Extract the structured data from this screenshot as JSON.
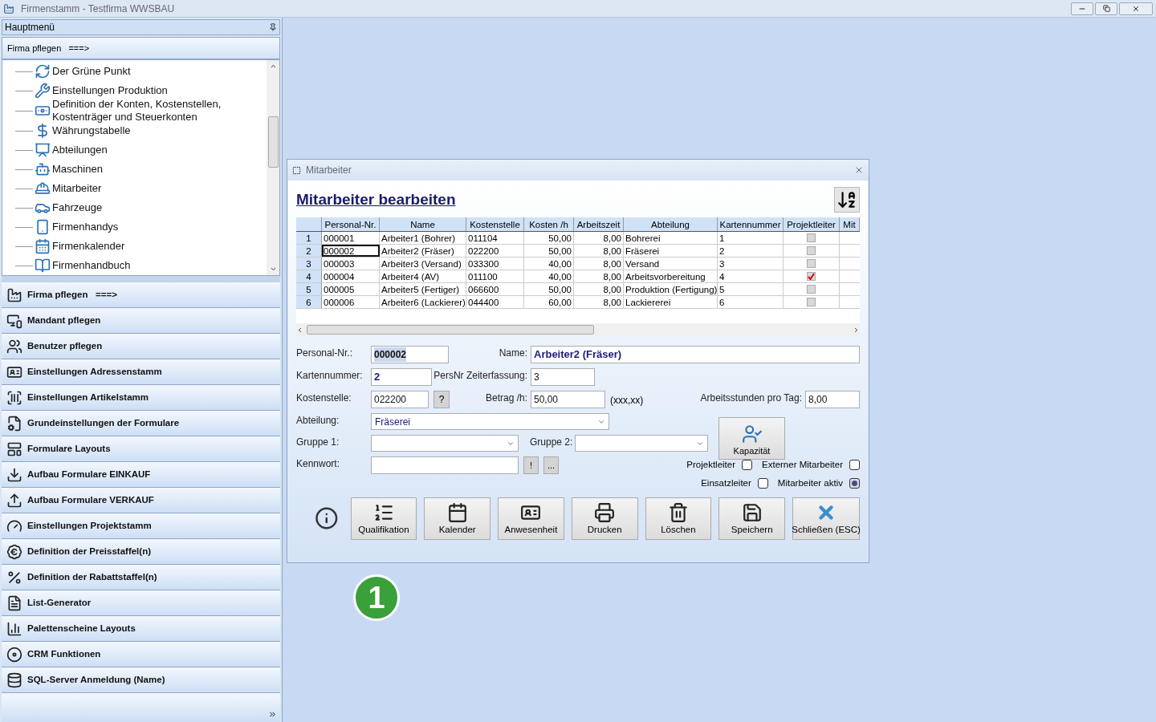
{
  "window": {
    "title": "Firmenstamm - Testfirma WWSBAU"
  },
  "sidebar": {
    "header": "Hauptmenü",
    "section": "Firma pflegen   ===>",
    "tree": [
      "Der Grüne Punkt",
      "Einstellungen Produktion",
      "Definition der Konten, Kostenstellen, Kostenträger und Steuerkonten",
      "Währungstabelle",
      "Abteilungen",
      "Maschinen",
      "Mitarbeiter",
      "Fahrzeuge",
      "Firmenhandys",
      "Firmenkalender",
      "Firmenhandbuch"
    ],
    "nav": [
      "Firma pflegen   ===>",
      "Mandant pflegen",
      "Benutzer pflegen",
      "Einstellungen Adressenstamm",
      "Einstellungen Artikelstamm",
      "Grundeinstellungen der Formulare",
      "Formulare Layouts",
      "Aufbau Formulare EINKAUF",
      "Aufbau Formulare VERKAUF",
      "Einstellungen Projektstamm",
      "Definition der Preisstaffel(n)",
      "Definition der Rabattstaffel(n)",
      "List-Generator",
      "Palettenscheine Layouts",
      "CRM Funktionen",
      "SQL-Server Anmeldung (Name)"
    ]
  },
  "dialog": {
    "title": "Mitarbeiter",
    "heading": "Mitarbeiter bearbeiten",
    "table": {
      "columns": [
        "Personal-Nr.",
        "Name",
        "Kostenstelle",
        "Kosten /h",
        "Arbeitszeit",
        "Abteilung",
        "Kartennummer",
        "Projektleiter",
        "Mit"
      ],
      "rows": [
        {
          "number": "1",
          "cells": [
            "000001",
            "Arbeiter1 (Bohrer)",
            "011104",
            "50,00",
            "8,00",
            "Bohrerei",
            "1"
          ],
          "projektleiter": false,
          "selected": false
        },
        {
          "number": "2",
          "cells": [
            "000002",
            "Arbeiter2 (Fräser)",
            "022200",
            "50,00",
            "8,00",
            "Fräserei",
            "2"
          ],
          "projektleiter": false,
          "selected": true
        },
        {
          "number": "3",
          "cells": [
            "000003",
            "Arbeiter3 (Versand)",
            "033300",
            "40,00",
            "8,00",
            "Versand",
            "3"
          ],
          "projektleiter": false,
          "selected": false
        },
        {
          "number": "4",
          "cells": [
            "000004",
            "Arbeiter4 (AV)",
            "011100",
            "40,00",
            "8,00",
            "Arbeitsvorbereitung",
            "4"
          ],
          "projektleiter": true,
          "selected": false
        },
        {
          "number": "5",
          "cells": [
            "000005",
            "Arbeiter5 (Fertiger)",
            "066600",
            "50,00",
            "8,00",
            "Produktion (Fertigung)",
            "5"
          ],
          "projektleiter": false,
          "selected": false
        },
        {
          "number": "6",
          "cells": [
            "000006",
            "Arbeiter6 (Lackierer)",
            "044400",
            "60,00",
            "8,00",
            "Lackiererei",
            "6"
          ],
          "projektleiter": false,
          "selected": false
        }
      ]
    },
    "form": {
      "personal_nr": {
        "label": "Personal-Nr.:",
        "value": "000002"
      },
      "name": {
        "label": "Name:",
        "value": "Arbeiter2 (Fräser)"
      },
      "kartennummer": {
        "label": "Kartennummer:",
        "value": "2"
      },
      "zeiterfassung": {
        "label": "PersNr Zeiterfassung:",
        "value": "3"
      },
      "kostenstelle": {
        "label": "Kostenstelle:",
        "value": "022200",
        "button": "?"
      },
      "betrag": {
        "label": "Betrag /h:",
        "value": "50,00",
        "hint": "(xxx,xx)"
      },
      "arbeitsstunden": {
        "label": "Arbeitsstunden pro Tag:",
        "value": "8,00"
      },
      "abteilung": {
        "label": "Abteilung:",
        "value": "Fräserei"
      },
      "gruppe1": {
        "label": "Gruppe 1:"
      },
      "gruppe2": {
        "label": "Gruppe 2:"
      },
      "kennwort": {
        "label": "Kennwort:",
        "buttons": [
          "!",
          "..."
        ]
      },
      "kapazitaet": "Kapazität",
      "checkboxes": [
        {
          "label": "Projektleiter",
          "checked": false
        },
        {
          "label": "Externer Mitarbeiter",
          "checked": false
        },
        {
          "label": "Einsatzleiter",
          "checked": false
        },
        {
          "label": "Mitarbeiter aktiv",
          "checked": true
        }
      ]
    },
    "buttons": [
      "Qualifikation",
      "Kalender",
      "Anwesenheit",
      "Drucken",
      "Löschen",
      "Speichern",
      "Schließen (ESC)"
    ]
  },
  "callout": "1"
}
